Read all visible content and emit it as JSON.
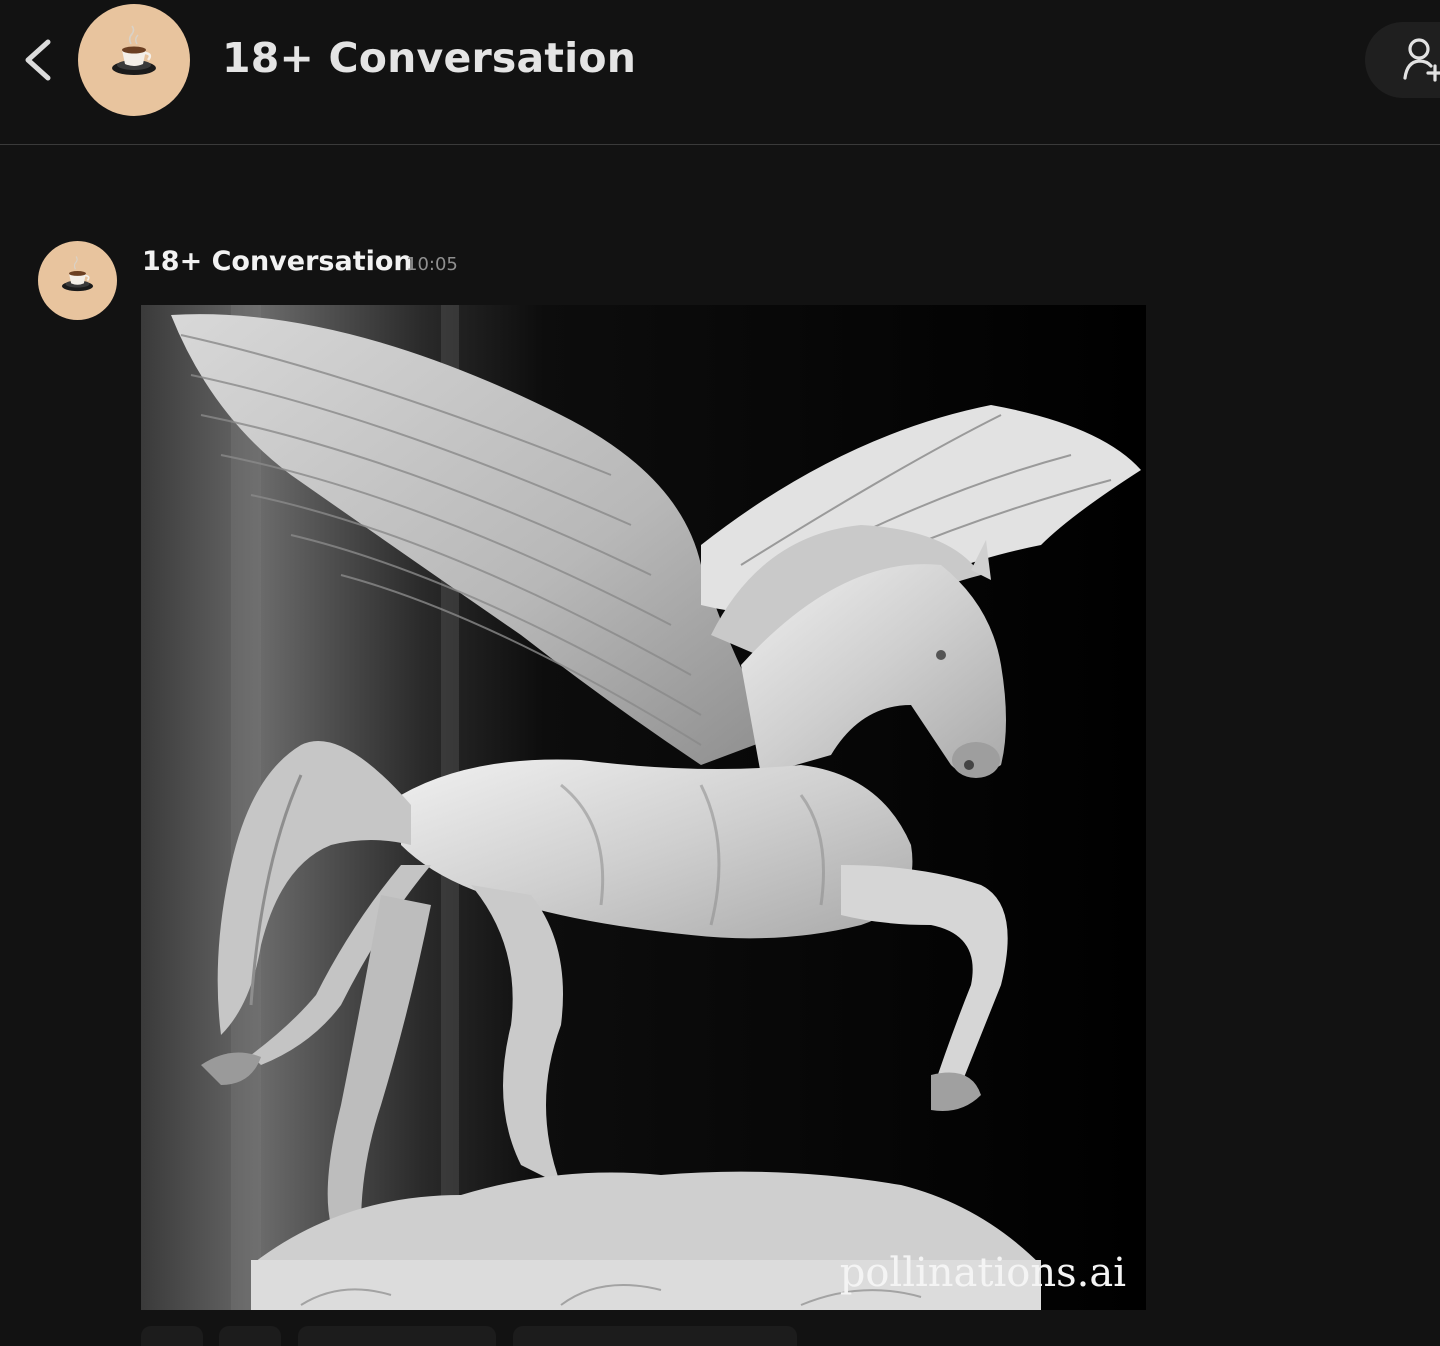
{
  "header": {
    "title": "18+ Conversation",
    "back_icon": "chevron-left-icon",
    "avatar_icon": "coffee-cup-icon",
    "add_user_icon": "add-user-icon"
  },
  "message": {
    "author": "18+ Conversation",
    "time": "10:05",
    "avatar_icon": "coffee-cup-icon",
    "image": {
      "subject": "white marble pegasus statue",
      "watermark": "pollinations.ai"
    }
  },
  "colors": {
    "background": "#121212",
    "avatar_bg": "#e8c49e",
    "header_divider": "#3a3a3a",
    "timestamp": "#8f8f8f"
  }
}
